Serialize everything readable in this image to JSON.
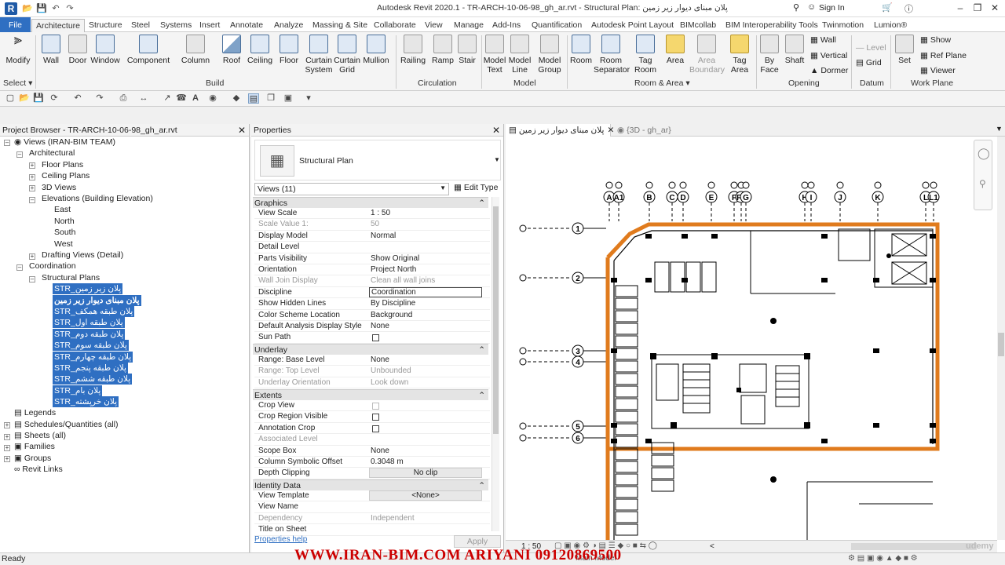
{
  "app": {
    "logo_letter": "R",
    "title": "Autodesk Revit 2020.1 - TR-ARCH-10-06-98_gh_ar.rvt - Structural Plan: پلان مبنای دیوار زیر زمین",
    "sign_in": "Sign In"
  },
  "tabs": [
    "File",
    "Architecture",
    "Structure",
    "Steel",
    "Systems",
    "Insert",
    "Annotate",
    "Analyze",
    "Massing & Site",
    "Collaborate",
    "View",
    "Manage",
    "Add-Ins",
    "Quantification",
    "Autodesk Point Layout",
    "BIMcollab",
    "BIM Interoperability Tools",
    "Twinmotion",
    "Lumion®"
  ],
  "ribbon": {
    "select": "Select",
    "buttons": [
      "Modify",
      "Wall",
      "Door",
      "Window",
      "Component",
      "Column",
      "Roof",
      "Ceiling",
      "Floor",
      "Curtain System",
      "Curtain Grid",
      "Mullion",
      "Railing",
      "Ramp",
      "Stair",
      "Model Text",
      "Model Line",
      "Model Group",
      "Room",
      "Room Separator",
      "Tag Room",
      "Area",
      "Area Boundary",
      "Tag Area",
      "By Face",
      "Shaft"
    ],
    "opening_small": [
      "Wall",
      "Vertical",
      "Dormer"
    ],
    "datum_small": [
      "Level",
      "Grid"
    ],
    "set": "Set",
    "workplane_small": [
      "Show",
      "Ref Plane",
      "Viewer"
    ],
    "panels": [
      "Build",
      "Circulation",
      "Model",
      "Room & Area",
      "Opening",
      "Datum",
      "Work Plane"
    ]
  },
  "browser": {
    "title": "Project Browser - TR-ARCH-10-06-98_gh_ar.rvt",
    "root": "Views (IRAN-BIM TEAM)",
    "items": [
      "Architectural",
      "Floor Plans",
      "Ceiling Plans",
      "3D Views",
      "Elevations (Building Elevation)",
      "East",
      "North",
      "South",
      "West",
      "Drafting Views (Detail)",
      "Coordination",
      "Structural Plans"
    ],
    "structural_plans": [
      "STR_پلان زیر زمین",
      "پلان مبنای دیوار زیر زمین",
      "STR_پلان طبقه همکف",
      "STR_پلان طبقه اول",
      "STR_پلان طبقه دوم",
      "STR_پلان طبقه سوم",
      "STR_پلان طبقه چهارم",
      "STR_پلان طبقه پنجم",
      "STR_پلان طبقه ششم",
      "STR_پلان بام",
      "STR_پلان خرپشته"
    ],
    "bottom": [
      "Legends",
      "Schedules/Quantities (all)",
      "Sheets (all)",
      "Families",
      "Groups",
      "Revit Links"
    ]
  },
  "properties": {
    "title": "Properties",
    "type_name": "Structural Plan",
    "selector": "Views (11)",
    "edit_type": "Edit Type",
    "sections": {
      "graphics": "Graphics",
      "underlay": "Underlay",
      "extents": "Extents",
      "identity": "Identity Data"
    },
    "rows": [
      {
        "k": "View Scale",
        "v": "1 : 50"
      },
      {
        "k": "Scale Value    1:",
        "v": "50",
        "dis": true
      },
      {
        "k": "Display Model",
        "v": "Normal"
      },
      {
        "k": "Detail Level",
        "v": ""
      },
      {
        "k": "Parts Visibility",
        "v": "Show Original"
      },
      {
        "k": "Orientation",
        "v": "Project North"
      },
      {
        "k": "Wall Join Display",
        "v": "Clean all wall joins",
        "dis": true
      },
      {
        "k": "Discipline",
        "v": "Coordination"
      },
      {
        "k": "Show Hidden Lines",
        "v": "By Discipline"
      },
      {
        "k": "Color Scheme Location",
        "v": "Background"
      },
      {
        "k": "Default Analysis Display Style",
        "v": "None"
      },
      {
        "k": "Sun Path",
        "v": ""
      }
    ],
    "underlay_rows": [
      {
        "k": "Range: Base Level",
        "v": "None"
      },
      {
        "k": "Range: Top Level",
        "v": "Unbounded",
        "dis": true
      },
      {
        "k": "Underlay Orientation",
        "v": "Look down",
        "dis": true
      }
    ],
    "extents_rows": [
      {
        "k": "Crop View",
        "v": ""
      },
      {
        "k": "Crop Region Visible",
        "v": ""
      },
      {
        "k": "Annotation Crop",
        "v": ""
      },
      {
        "k": "Associated Level",
        "v": "",
        "dis": true
      },
      {
        "k": "Scope Box",
        "v": "None"
      },
      {
        "k": "Column Symbolic Offset",
        "v": "0.3048 m"
      },
      {
        "k": "Depth Clipping",
        "v": "No clip"
      }
    ],
    "identity_rows": [
      {
        "k": "View Template",
        "v": "<None>"
      },
      {
        "k": "View Name",
        "v": ""
      },
      {
        "k": "Dependency",
        "v": "Independent",
        "dis": true
      },
      {
        "k": "Title on Sheet",
        "v": ""
      }
    ],
    "help": "Properties help",
    "apply": "Apply"
  },
  "views": {
    "tab1": "پلان مبنای دیوار زیر زمین",
    "tab2": "{3D - gh_ar}"
  },
  "grids_top": [
    "A",
    "A1",
    "B",
    "C",
    "D",
    "E",
    "F",
    "F1",
    "G",
    "H",
    "I",
    "J",
    "K",
    "L",
    "L1"
  ],
  "grids_left": [
    "1",
    "2",
    "3",
    "4",
    "5",
    "6"
  ],
  "status": {
    "ready": "Ready",
    "scale": "1 : 50",
    "model": "Main Model"
  },
  "watermark": "WWW.IRAN-BIM.COM    ARIYANI  09120869500",
  "brand": "udemy"
}
